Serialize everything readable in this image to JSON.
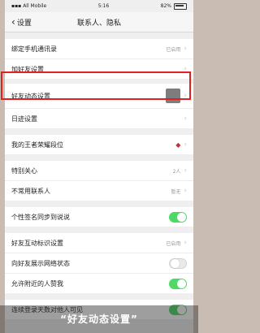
{
  "status_bar": {
    "carrier": "All Mobile",
    "time": "5:16",
    "battery": "82%"
  },
  "nav": {
    "back_label": "设置",
    "title": "联系人、隐私"
  },
  "rows": [
    {
      "label": "绑定手机通讯录",
      "value": "已启用"
    },
    {
      "label": "加好友设置",
      "value": ""
    },
    {
      "label": "好友动态设置",
      "value": ""
    },
    {
      "label": "日迹设置",
      "value": ""
    },
    {
      "label": "我的王者荣耀段位",
      "value": ""
    },
    {
      "label": "特别关心",
      "value": "2人"
    },
    {
      "label": "不常用联系人",
      "value": "暂无"
    },
    {
      "label": "个性签名同步到说说",
      "value": ""
    },
    {
      "label": "好友互动标识设置",
      "value": "已启用"
    },
    {
      "label": "向好友展示网络状态",
      "value": ""
    },
    {
      "label": "允许附近的人赞我",
      "value": ""
    },
    {
      "label": "连续登录天数对他人可见",
      "value": ""
    }
  ],
  "toggles": {
    "signature_sync": true,
    "network_status": false,
    "nearby_like": true,
    "login_days": true
  },
  "caption": "“好友动态设置”",
  "colors": {
    "highlight": "#e02020",
    "toggle_on": "#4cd964"
  },
  "icons": {
    "back": "chevron-left-icon",
    "row_arrow": "chevron-right-icon"
  }
}
